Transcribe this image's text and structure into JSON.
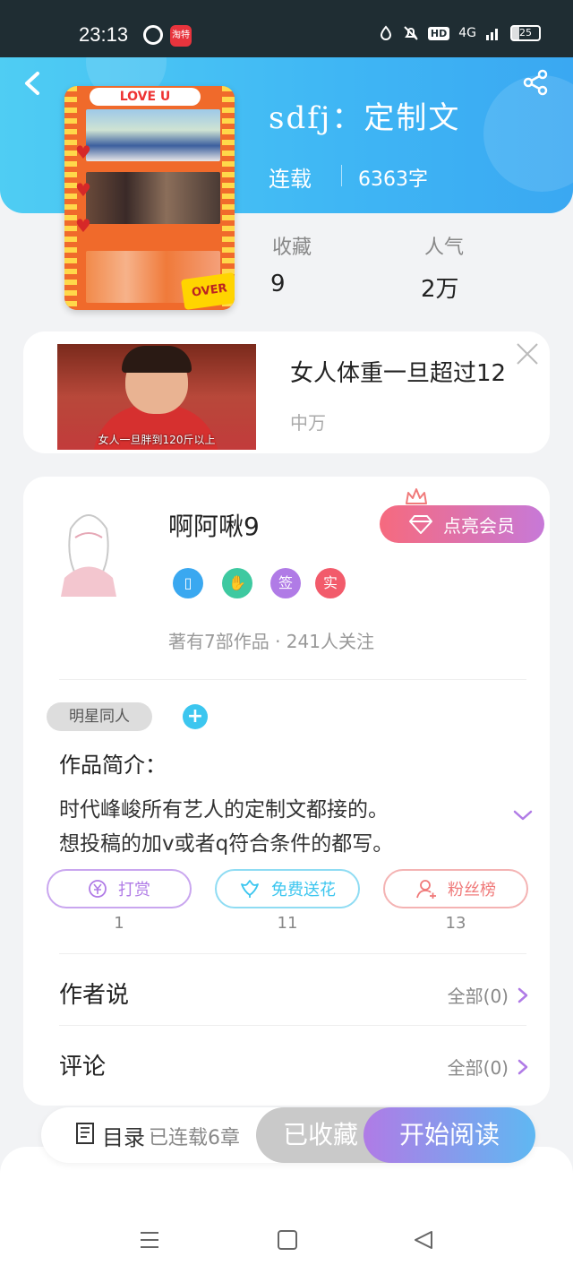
{
  "status_bar": {
    "time": "23:13",
    "app_badge_text": "淘特",
    "network": "HD",
    "signal_text": "4G",
    "battery_level": "25"
  },
  "book": {
    "title": "sdfj：定制文",
    "status": "连载",
    "word_count": "6363字",
    "stats": {
      "favorites_label": "收藏",
      "favorites_value": "9",
      "popularity_label": "人气",
      "popularity_value": "2万"
    },
    "cover": {
      "title_text": "LOVE U",
      "badge_text": "OVER"
    }
  },
  "ad": {
    "title": "女人体重一旦超过12",
    "source": "中万",
    "image_caption": "女人一旦胖到120斤以上"
  },
  "author": {
    "name": "啊阿啾9",
    "vip_button_label": "点亮会员",
    "badges": [
      {
        "icon": "phone-badge-icon",
        "color": "#3aa8f0",
        "glyph": "▯"
      },
      {
        "icon": "handshake-badge-icon",
        "color": "#3ec9a0",
        "glyph": "✋"
      },
      {
        "icon": "sign-badge-icon",
        "color": "#b07be6",
        "glyph": "签"
      },
      {
        "icon": "real-badge-icon",
        "color": "#f25b6b",
        "glyph": "实"
      }
    ],
    "meta": "著有7部作品 · 241人关注"
  },
  "work": {
    "tag": "明星同人",
    "intro_heading": "作品简介：",
    "intro_lines": [
      "时代峰峻所有艺人的定制文都接的。",
      "想投稿的加v或者q符合条件的都写。"
    ]
  },
  "actions": [
    {
      "label": "打赏",
      "count": "1",
      "color": "#b07be6",
      "icon": "coin-icon"
    },
    {
      "label": "免费送花",
      "count": "11",
      "color": "#3cc6ef",
      "icon": "flower-icon"
    },
    {
      "label": "粉丝榜",
      "count": "13",
      "color": "#f07a7a",
      "icon": "fan-icon"
    }
  ],
  "rows": {
    "author_says_label": "作者说",
    "author_says_link": "全部(0)",
    "comments_label": "评论",
    "comments_link": "全部(0)"
  },
  "bottom_bar": {
    "toc_label": "目录",
    "chapter_count": "已连载6章",
    "collected_label": "已收藏",
    "read_label": "开始阅读"
  },
  "colors": {
    "hero": "#3fb6f4",
    "vip_start": "#f66a7e",
    "vip_end": "#c779d8",
    "read_start": "#b07be6",
    "read_end": "#5fb8f2"
  }
}
